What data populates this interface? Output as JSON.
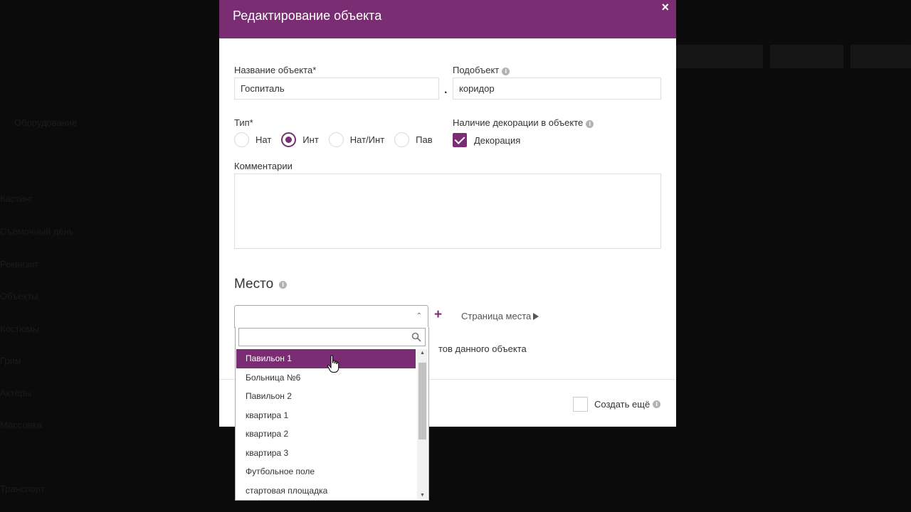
{
  "background": {
    "items": [
      "Оборудование",
      "Кастинг",
      "Съёмочный день",
      "Реквизит",
      "Объекты",
      "Костюмы",
      "Грим",
      "Актёры",
      "Массовка",
      "Транспорт"
    ]
  },
  "modal": {
    "title": "Редактирование объекта",
    "close_icon": "×",
    "object_name_label": "Название объекта",
    "object_name_required": "*",
    "object_name_value": "Госпиталь",
    "subobject_label": "Подобъект",
    "subobject_value": "коридор",
    "separator": ".",
    "type_label": "Тип",
    "type_required": "*",
    "type_options": [
      "Нат",
      "Инт",
      "Нат/Инт",
      "Пав"
    ],
    "type_selected": "Инт",
    "decoration_label": "Наличие декорации в объекте",
    "decoration_checkbox_label": "Декорация",
    "decoration_checked": true,
    "comments_label": "Комментарии",
    "place_title": "Место",
    "add_icon": "+",
    "place_page_link": "Страница места",
    "partial_text": "тов данного объекта",
    "create_more_label": "Создать ещё"
  },
  "dropdown": {
    "search_value": "",
    "items": [
      "Павильон 1",
      "Больница №6",
      "Павильон 2",
      "квартира 1",
      "квартира 2",
      "квартира 3",
      "Футбольное поле",
      "стартовая площадка"
    ],
    "highlighted": "Павильон 1"
  },
  "colors": {
    "accent": "#7b2d73",
    "overlay": "#0b0b0b"
  },
  "icons": {
    "info": "info-icon",
    "search": "search-icon",
    "close": "close-icon",
    "caret": "chevron-up-icon"
  }
}
